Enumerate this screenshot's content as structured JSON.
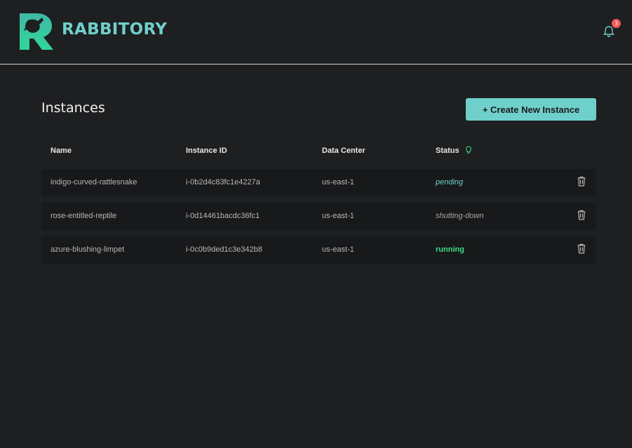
{
  "app": {
    "brand": "RABBITORY",
    "notifications_count": "3",
    "colors": {
      "accent": "#6fcfcb",
      "badge": "#f15a5a",
      "pending": "#6fcfcb",
      "running": "#3ddc84"
    }
  },
  "page": {
    "title": "Instances",
    "create_button": "+ Create New Instance"
  },
  "table": {
    "headers": {
      "name": "Name",
      "id": "Instance ID",
      "dc": "Data Center",
      "status": "Status"
    },
    "rows": [
      {
        "name": "indigo-curved-rattlesnake",
        "id": "i-0b2d4c83fc1e4227a",
        "dc": "us-east-1",
        "status": "pending"
      },
      {
        "name": "rose-entitled-reptile",
        "id": "i-0d14461bacdc36fc1",
        "dc": "us-east-1",
        "status": "shutting-down"
      },
      {
        "name": "azure-blushing-limpet",
        "id": "i-0c0b9ded1c3e342b8",
        "dc": "us-east-1",
        "status": "running"
      }
    ]
  },
  "icons": [
    "rabbit-logo-icon",
    "bell-icon",
    "lightbulb-icon",
    "trash-icon"
  ]
}
